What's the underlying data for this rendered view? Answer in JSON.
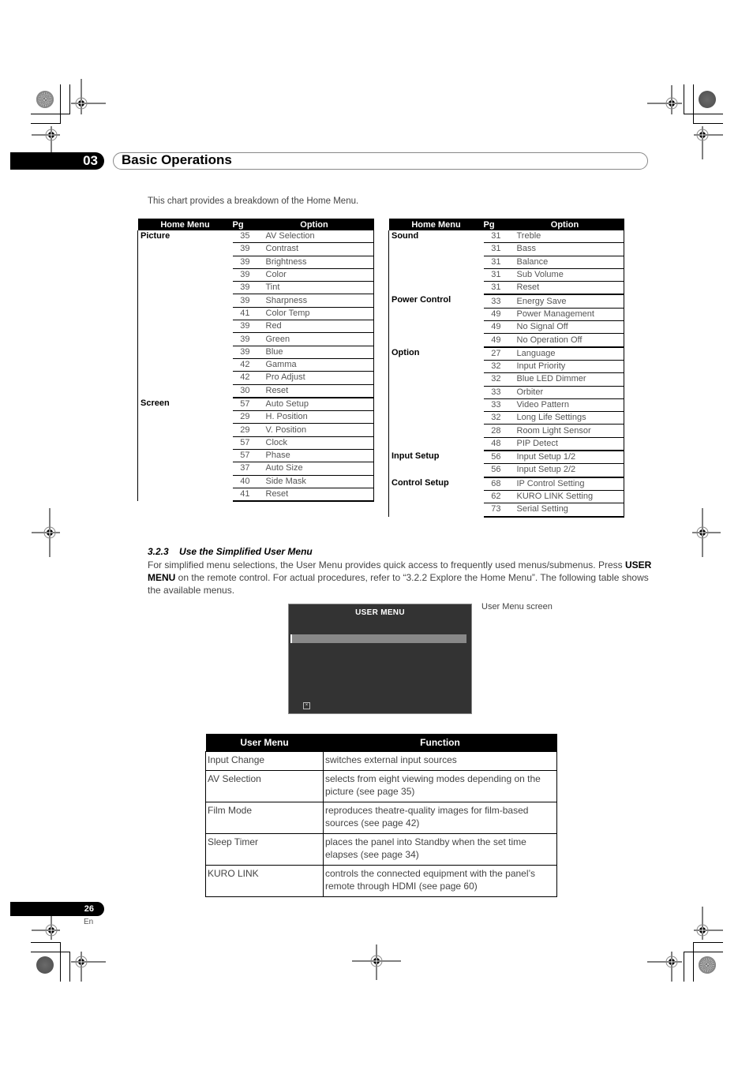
{
  "chapter": {
    "number": "03",
    "title": "Basic Operations"
  },
  "intro_text": "This chart provides a breakdown of the Home Menu.",
  "home_menu_tables": [
    {
      "headers": {
        "menu": "Home Menu",
        "pg": "Pg",
        "option": "Option"
      },
      "groups": [
        {
          "menu": "Picture",
          "rows": [
            {
              "pg": "35",
              "option": "AV Selection"
            },
            {
              "pg": "39",
              "option": "Contrast"
            },
            {
              "pg": "39",
              "option": "Brightness"
            },
            {
              "pg": "39",
              "option": "Color"
            },
            {
              "pg": "39",
              "option": "Tint"
            },
            {
              "pg": "39",
              "option": "Sharpness"
            },
            {
              "pg": "41",
              "option": "Color Temp"
            },
            {
              "pg": "39",
              "option": "Red"
            },
            {
              "pg": "39",
              "option": "Green"
            },
            {
              "pg": "39",
              "option": "Blue"
            },
            {
              "pg": "42",
              "option": "Gamma"
            },
            {
              "pg": "42",
              "option": "Pro Adjust"
            },
            {
              "pg": "30",
              "option": "Reset"
            }
          ]
        },
        {
          "menu": "Screen",
          "rows": [
            {
              "pg": "57",
              "option": "Auto Setup"
            },
            {
              "pg": "29",
              "option": "H. Position"
            },
            {
              "pg": "29",
              "option": "V. Position"
            },
            {
              "pg": "57",
              "option": "Clock"
            },
            {
              "pg": "57",
              "option": "Phase"
            },
            {
              "pg": "37",
              "option": "Auto Size"
            },
            {
              "pg": "40",
              "option": "Side Mask"
            },
            {
              "pg": "41",
              "option": "Reset"
            }
          ]
        }
      ]
    },
    {
      "headers": {
        "menu": "Home Menu",
        "pg": "Pg",
        "option": "Option"
      },
      "groups": [
        {
          "menu": "Sound",
          "rows": [
            {
              "pg": "31",
              "option": "Treble"
            },
            {
              "pg": "31",
              "option": "Bass"
            },
            {
              "pg": "31",
              "option": "Balance"
            },
            {
              "pg": "31",
              "option": "Sub Volume"
            },
            {
              "pg": "31",
              "option": "Reset"
            }
          ]
        },
        {
          "menu": "Power Control",
          "rows": [
            {
              "pg": "33",
              "option": "Energy Save"
            },
            {
              "pg": "49",
              "option": "Power Management"
            },
            {
              "pg": "49",
              "option": "No Signal Off"
            },
            {
              "pg": "49",
              "option": "No Operation Off"
            }
          ]
        },
        {
          "menu": "Option",
          "rows": [
            {
              "pg": "27",
              "option": "Language"
            },
            {
              "pg": "32",
              "option": "Input Priority"
            },
            {
              "pg": "32",
              "option": "Blue LED Dimmer"
            },
            {
              "pg": "33",
              "option": "Orbiter"
            },
            {
              "pg": "33",
              "option": "Video Pattern"
            },
            {
              "pg": "32",
              "option": "Long Life Settings"
            },
            {
              "pg": "28",
              "option": "Room Light Sensor"
            },
            {
              "pg": "48",
              "option": "PIP Detect"
            }
          ]
        },
        {
          "menu": "Input Setup",
          "rows": [
            {
              "pg": "56",
              "option": "Input Setup 1/2"
            },
            {
              "pg": "56",
              "option": "Input Setup 2/2"
            }
          ]
        },
        {
          "menu": "Control Setup",
          "rows": [
            {
              "pg": "68",
              "option": "IP Control Setting"
            },
            {
              "pg": "62",
              "option": "KURO LINK Setting"
            },
            {
              "pg": "73",
              "option": "Serial Setting"
            }
          ]
        }
      ]
    }
  ],
  "section": {
    "number": "3.2.3",
    "title": "Use the Simplified User Menu",
    "para_1": "For simplified menu selections, the User Menu provides quick access to frequently used menus/submenus. Press ",
    "para_bold": "USER MENU",
    "para_2": " on the remote control. For actual procedures, refer to “3.2.2 Explore the Home Menu”. The following table shows the available menus."
  },
  "user_menu_screen": {
    "title": "USER MENU",
    "caption": "User Menu screen",
    "close_icon_glyph": "×"
  },
  "user_menu_table": {
    "headers": {
      "menu": "User Menu",
      "function": "Function"
    },
    "rows": [
      {
        "menu": "Input Change",
        "function": "switches external input sources"
      },
      {
        "menu": "AV Selection",
        "function": "selects from eight viewing modes depending on the picture (see page 35)"
      },
      {
        "menu": "Film Mode",
        "function": "reproduces theatre-quality images for film-based sources (see page 42)"
      },
      {
        "menu": "Sleep Timer",
        "function": "places the panel into Standby when the set time elapses (see page 34)"
      },
      {
        "menu": "KURO LINK",
        "function": "controls the connected equipment with the panel’s remote through HDMI (see page 60)"
      }
    ]
  },
  "footer": {
    "page_number": "26",
    "language": "En"
  }
}
